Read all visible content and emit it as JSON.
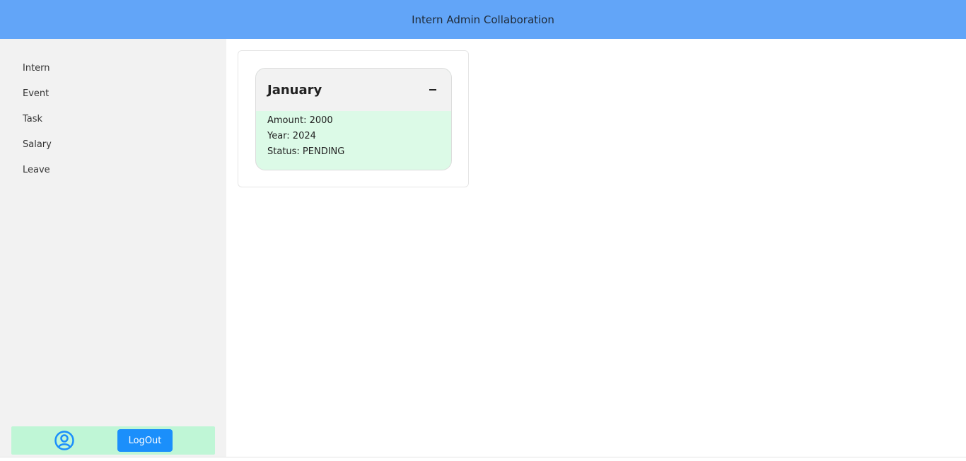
{
  "header": {
    "title": "Intern Admin Collaboration"
  },
  "sidebar": {
    "items": [
      {
        "label": "Intern"
      },
      {
        "label": "Event"
      },
      {
        "label": "Task"
      },
      {
        "label": "Salary"
      },
      {
        "label": "Leave"
      }
    ],
    "footer": {
      "user_icon": "user-circle-icon",
      "logout_label": "LogOut"
    }
  },
  "main": {
    "salary_card": {
      "month": "January",
      "collapse_icon": "minus-icon",
      "amount": "Amount: 2000",
      "year": "Year: 2024",
      "status": "Status: PENDING"
    }
  },
  "colors": {
    "header_bg": "#62a5f8",
    "sidebar_bg": "#f2f2f2",
    "footer_bg": "#bff6d6",
    "logout_button": "#1b8ffb",
    "card_body_bg": "#dcfae7",
    "icon_blue": "#1b8ffb"
  }
}
